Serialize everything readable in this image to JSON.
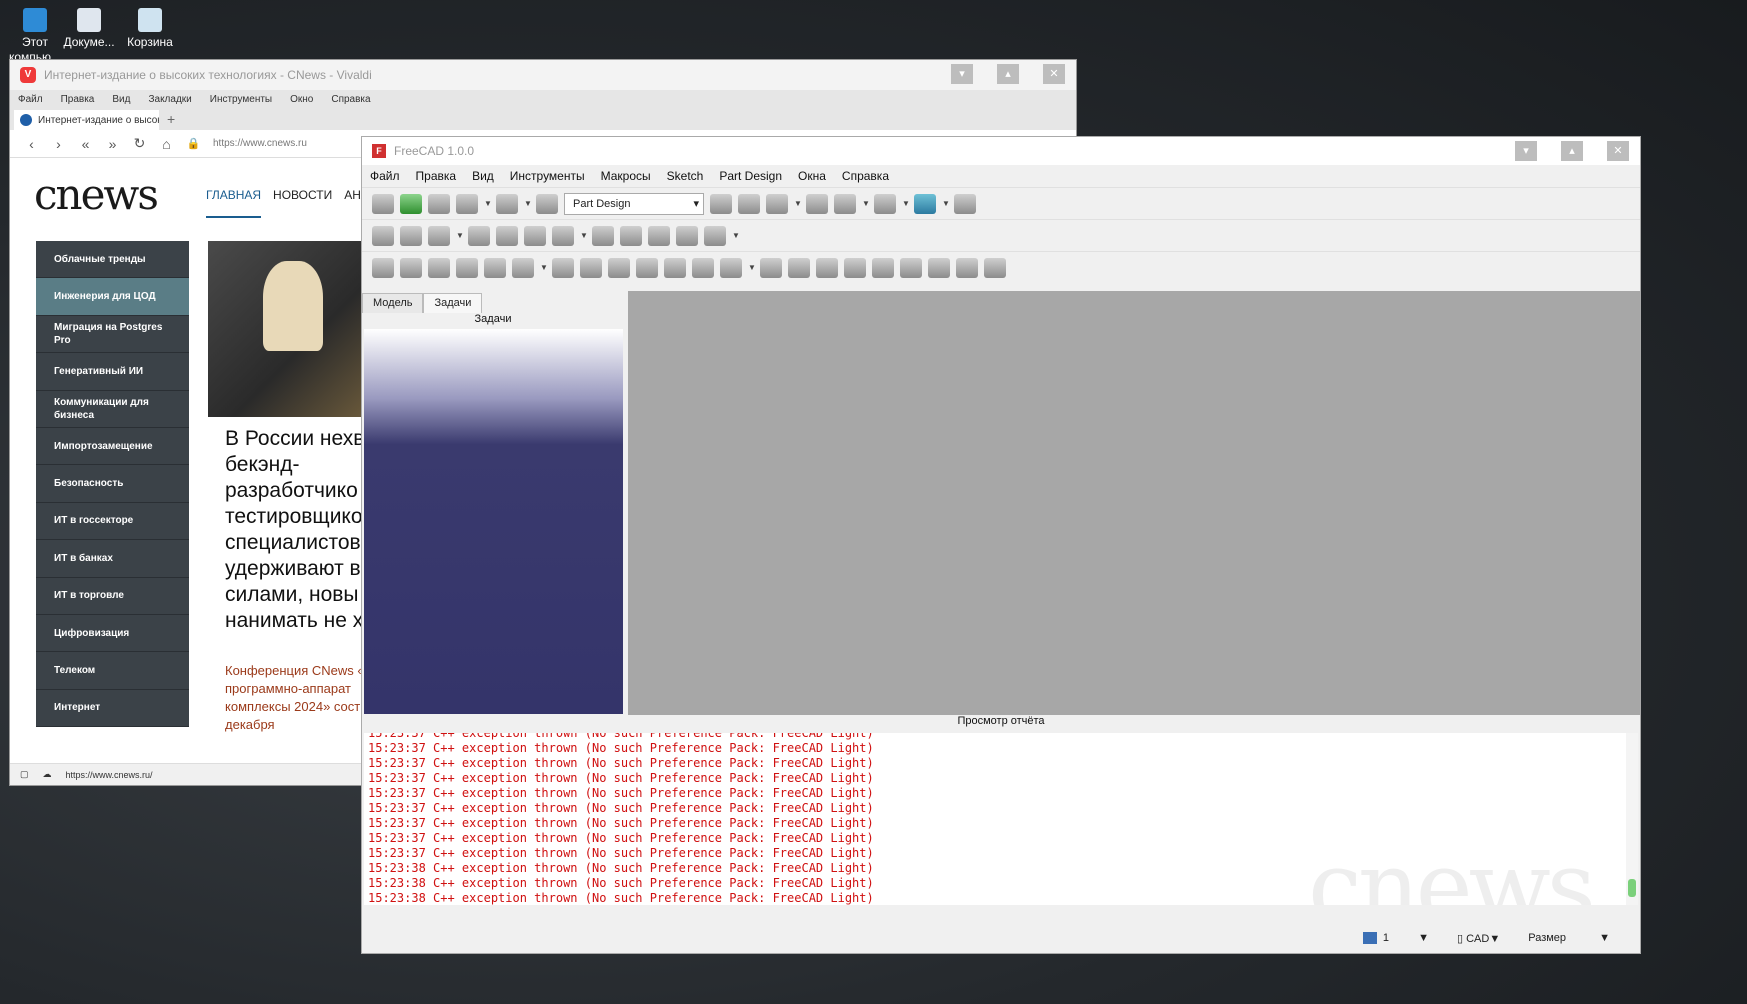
{
  "desktop": {
    "icons": [
      "Этот компью...",
      "Докуме...",
      "Корзина"
    ]
  },
  "browser": {
    "title": "Интернет-издание о высоких технологиях - CNews - Vivaldi",
    "menu": [
      "Файл",
      "Правка",
      "Вид",
      "Закладки",
      "Инструменты",
      "Окно",
      "Справка"
    ],
    "tab": "Интернет-издание о высок",
    "url": "https://www.cnews.ru",
    "status_url": "https://www.cnews.ru/",
    "logo": "cnews",
    "nav": [
      "ГЛАВНАЯ",
      "НОВОСТИ",
      "АНАЛ"
    ],
    "sidebar": [
      "Облачные тренды",
      "Инженерия для ЦОД",
      "Миграция на Postgres Pro",
      "Генеративный ИИ",
      "Коммуникации для бизнеса",
      "Импортозамещение",
      "Безопасность",
      "ИТ в госсекторе",
      "ИТ в банках",
      "ИТ в торговле",
      "Цифровизация",
      "Телеком",
      "Интернет"
    ],
    "headline": [
      "В России нехв",
      "бекэнд-",
      "разработчико",
      "тестировщико",
      "специалистов",
      "удерживают в",
      "силами, новы",
      "нанимать не х"
    ],
    "teaser": [
      "Конференция CNews «",
      "программно-аппарат",
      "комплексы 2024» сост",
      "декабря"
    ]
  },
  "freecad": {
    "title": "FreeCAD 1.0.0",
    "menu": [
      "Файл",
      "Правка",
      "Вид",
      "Инструменты",
      "Макросы",
      "Sketch",
      "Part Design",
      "Окна",
      "Справка"
    ],
    "workbench": "Part Design",
    "tabs": [
      "Модель",
      "Задачи"
    ],
    "panel_title": "Задачи",
    "report_title": "Просмотр отчёта",
    "log": [
      "15:23:37  C++ exception thrown (No such Preference Pack: FreeCAD Light)",
      "15:23:37  C++ exception thrown (No such Preference Pack: FreeCAD Light)",
      "15:23:37  C++ exception thrown (No such Preference Pack: FreeCAD Light)",
      "15:23:37  C++ exception thrown (No such Preference Pack: FreeCAD Light)",
      "15:23:37  C++ exception thrown (No such Preference Pack: FreeCAD Light)",
      "15:23:37  C++ exception thrown (No such Preference Pack: FreeCAD Light)",
      "15:23:37  C++ exception thrown (No such Preference Pack: FreeCAD Light)",
      "15:23:37  C++ exception thrown (No such Preference Pack: FreeCAD Light)",
      "15:23:37  C++ exception thrown (No such Preference Pack: FreeCAD Light)",
      "15:23:38  C++ exception thrown (No such Preference Pack: FreeCAD Light)",
      "15:23:38  C++ exception thrown (No such Preference Pack: FreeCAD Light)",
      "15:23:38  C++ exception thrown (No such Preference Pack: FreeCAD Light)"
    ],
    "watermark": "cnews",
    "status": {
      "page": "1",
      "nav_style": "CAD",
      "units": "Размер"
    }
  }
}
